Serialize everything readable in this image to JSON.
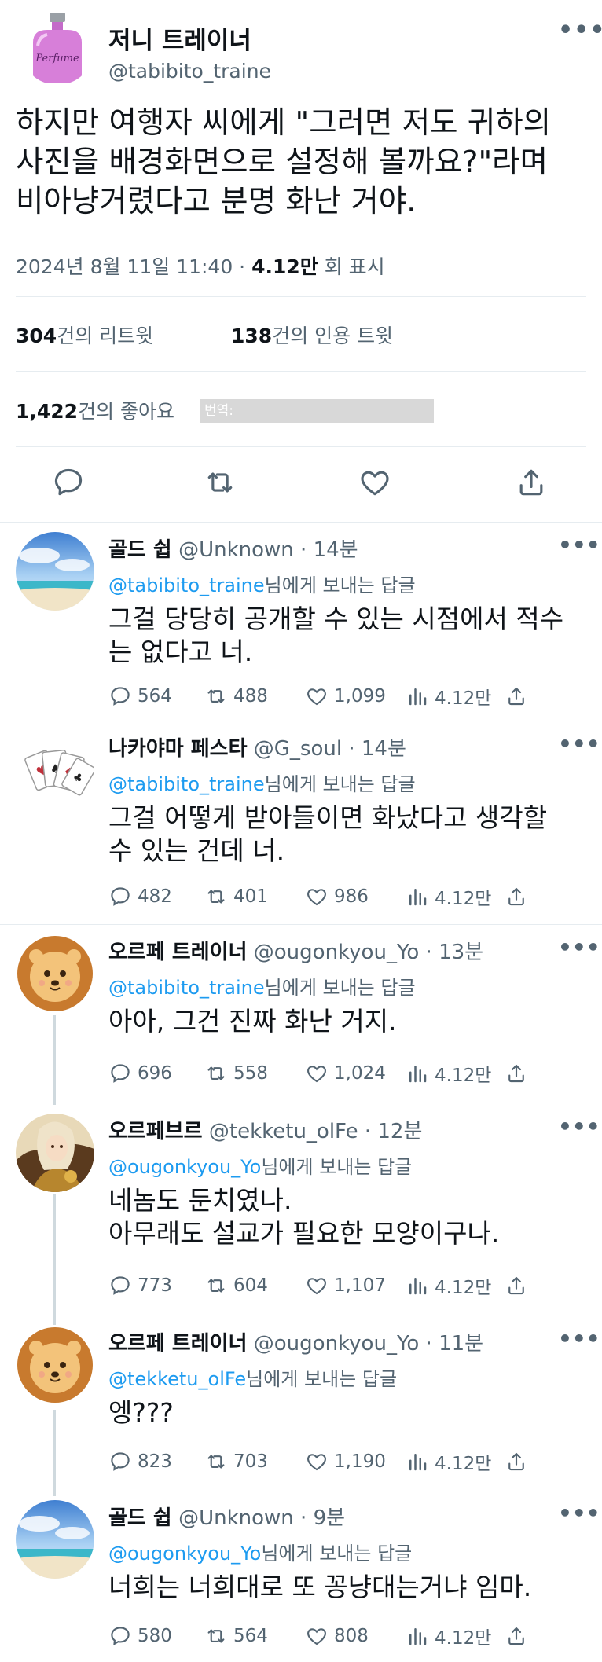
{
  "main_tweet": {
    "author_name": "저니 트레이너",
    "author_handle": "@tabibito_traine",
    "avatar_label": "Perfume",
    "more_label": "•••",
    "text": "하지만 여행자 씨에게 \"그러면 저도 귀하의\n사진을 배경화면으로 설정해 볼까요?\"라며\n비아냥거렸다고 분명 화난 거야.",
    "date": "2024년 8월 11일 11:40 · ",
    "views": "4.12만",
    "views_suffix": " 회 표시",
    "retweets": "304",
    "retweets_label": "건의 리트윗",
    "quotes": "138",
    "quotes_label": "건의 인용 트윗",
    "likes": "1,422",
    "likes_label": "건의 좋아요",
    "watermark": "번역: https://stadela0309.tistory.com"
  },
  "replies": [
    {
      "name": "골드 쉽",
      "handle": "@Unknown",
      "time": " · 14분",
      "reply_to": "@tabibito_traine",
      "reply_suffix": "님에게 보내는 답글",
      "text": "그걸 당당히 공개할 수 있는 시점에서 적수\n는 없다고 너.",
      "counts": {
        "replies": "564",
        "retweets": "488",
        "likes": "1,099",
        "views": "4.12만"
      }
    },
    {
      "name": "나카야마 페스타",
      "handle": "@G_soul",
      "time": " · 14분",
      "reply_to": "@tabibito_traine",
      "reply_suffix": "님에게 보내는 답글",
      "text": "그걸 어떻게 받아들이면 화났다고 생각할\n수 있는 건데 너.",
      "counts": {
        "replies": "482",
        "retweets": "401",
        "likes": "986",
        "views": "4.12만"
      }
    },
    {
      "name": "오르페 트레이너",
      "handle": "@ougonkyou_Yo",
      "time": " · 13분",
      "reply_to": "@tabibito_traine",
      "reply_suffix": "님에게 보내는 답글",
      "text": "아아, 그건 진짜 화난 거지.",
      "counts": {
        "replies": "696",
        "retweets": "558",
        "likes": "1,024",
        "views": "4.12만"
      }
    },
    {
      "name": "오르페브르",
      "handle": "@tekketu_olFe",
      "time": " · 12분",
      "reply_to": "@ougonkyou_Yo",
      "reply_suffix": "님에게 보내는 답글",
      "text": "네놈도 둔치였나.\n아무래도 설교가 필요한 모양이구나.",
      "counts": {
        "replies": "773",
        "retweets": "604",
        "likes": "1,107",
        "views": "4.12만"
      }
    },
    {
      "name": "오르페 트레이너",
      "handle": "@ougonkyou_Yo",
      "time": " · 11분",
      "reply_to": "@tekketu_olFe",
      "reply_suffix": "님에게 보내는 답글",
      "text": "엥???",
      "counts": {
        "replies": "823",
        "retweets": "703",
        "likes": "1,190",
        "views": "4.12만"
      }
    },
    {
      "name": "골드 쉽",
      "handle": "@Unknown",
      "time": " · 9분",
      "reply_to": "@ougonkyou_Yo",
      "reply_suffix": "님에게 보내는 답글",
      "text": "너희는 너희대로 또 꽁냥대는거냐 임마.",
      "counts": {
        "replies": "580",
        "retweets": "564",
        "likes": "808",
        "views": "4.12만"
      }
    }
  ],
  "colors": {
    "link": "#1d9bf0",
    "muted": "#536471",
    "text": "#0f1419",
    "divider": "#e6ecf0"
  },
  "icons": [
    "reply-icon",
    "retweet-icon",
    "like-icon",
    "share-icon",
    "views-icon",
    "more-icon"
  ]
}
